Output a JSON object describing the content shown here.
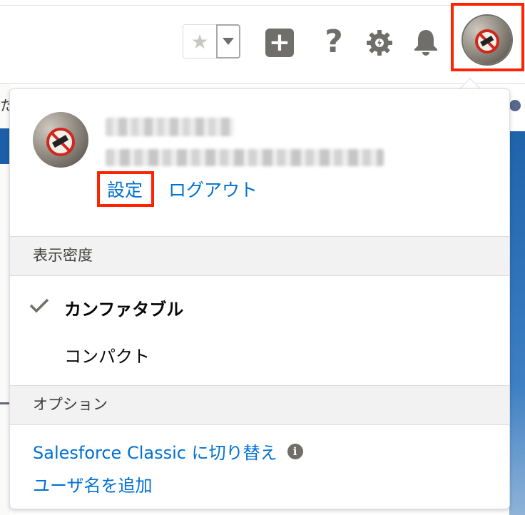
{
  "header": {
    "favorites_star_icon": "star-icon",
    "favorites_dropdown_icon": "chevron-down-icon",
    "add_icon": "plus-icon",
    "help_glyph": "?",
    "setup_icon": "gear-icon",
    "notifications_icon": "bell-icon",
    "avatar_icon": "user-avatar"
  },
  "background": {
    "left_fragment": "た"
  },
  "profile": {
    "settings_label": "設定",
    "logout_label": "ログアウト"
  },
  "density": {
    "header": "表示密度",
    "options": [
      {
        "label": "カンファタブル",
        "selected": true
      },
      {
        "label": "コンパクト",
        "selected": false
      }
    ]
  },
  "options": {
    "header": "オプション",
    "switch_classic_label": "Salesforce Classic に切り替え",
    "add_username_label": "ユーザ名を追加"
  },
  "colors": {
    "link": "#0070d2",
    "highlight": "#ff2400",
    "icon_gray": "#706e6b"
  }
}
